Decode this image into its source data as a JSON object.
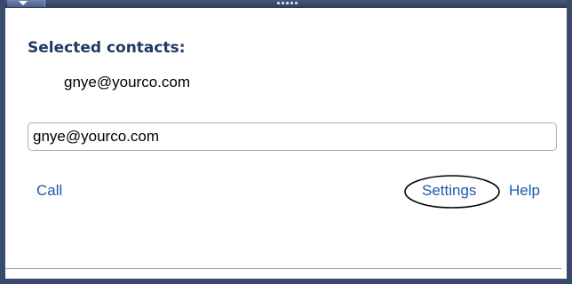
{
  "window": {
    "menu_icon": "dropdown-triangle-icon",
    "grip_icon": "drag-grip-icon"
  },
  "contacts": {
    "heading": "Selected contacts:",
    "items": [
      "gnye@yourco.com"
    ]
  },
  "address_field": {
    "value": "gnye@yourco.com"
  },
  "actions": {
    "call_label": "Call",
    "settings_label": "Settings",
    "help_label": "Help"
  },
  "colors": {
    "frame": "#3a4a6a",
    "heading": "#1e3a5f",
    "link": "#1c5aa8"
  }
}
